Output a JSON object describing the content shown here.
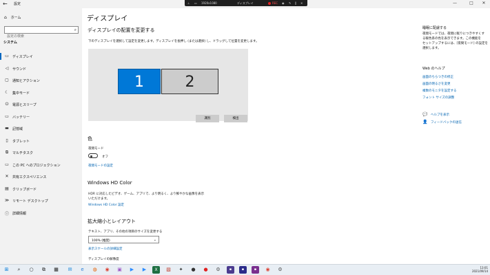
{
  "window": {
    "title": "設定",
    "back_icon": "back-arrow-icon",
    "controls": [
      "—",
      "□",
      "✕"
    ]
  },
  "recorder": {
    "resolution": "1920x1080",
    "display_title": "ディスプレイ",
    "rec_label": "REC"
  },
  "sidebar": {
    "home_label": "ホーム",
    "search_placeholder": "設定の検索",
    "section_label": "システム",
    "items": [
      {
        "label": "ディスプレイ",
        "icon": "monitor-icon",
        "selected": true
      },
      {
        "label": "サウンド",
        "icon": "speaker-icon"
      },
      {
        "label": "通知とアクション",
        "icon": "notification-icon"
      },
      {
        "label": "集中モード",
        "icon": "moon-icon"
      },
      {
        "label": "電源とスリープ",
        "icon": "power-icon"
      },
      {
        "label": "バッテリー",
        "icon": "battery-icon"
      },
      {
        "label": "記憶域",
        "icon": "storage-icon"
      },
      {
        "label": "タブレット",
        "icon": "tablet-icon"
      },
      {
        "label": "マルチタスク",
        "icon": "multitask-icon"
      },
      {
        "label": "この PC へのプロジェクション",
        "icon": "projection-icon"
      },
      {
        "label": "共有エクスペリエンス",
        "icon": "share-icon"
      },
      {
        "label": "クリップボード",
        "icon": "clipboard-icon"
      },
      {
        "label": "リモート デスクトップ",
        "icon": "remote-icon"
      },
      {
        "label": "詳細情報",
        "icon": "info-icon"
      }
    ]
  },
  "main": {
    "page_title": "ディスプレイ",
    "arrange_heading": "ディスプレイの配置を変更する",
    "arrange_desc": "下のディスプレイを選択して設定を変更します。ディスプレイを長押し (または選択) し、ドラッグして位置を変更します。",
    "monitor1": "1",
    "monitor2": "2",
    "identify_button": "識別",
    "detect_button": "検出",
    "color_heading": "色",
    "night_mode_label": "夜間モード",
    "night_mode_state": "オフ",
    "night_mode_link": "夜間モードの設定",
    "hdr_heading": "Windows HD Color",
    "hdr_desc_1": "HDR に対応したビデオ、ゲーム、アプリで、より明るく、より鮮やかな画像を表示",
    "hdr_desc_2": "いただけます。",
    "hdr_link": "Windows HD Color 設定",
    "scale_heading": "拡大縮小とレイアウト",
    "scale_label": "テキスト、アプリ、その他の項目のサイズを変更する",
    "scale_value": "100% (推奨)",
    "scale_link": "表示スケールの詳細設定",
    "resolution_label": "ディスプレイの解像度"
  },
  "right_panel": {
    "tip_heading": "睡眠に配慮する",
    "tip_text_1": "夜間モードでは、夜間に眠りにつきやすくす",
    "tip_text_2": "る暖色系の色を表示できます。この機能を",
    "tip_text_3": "セットアップするには、[夜間モード] の設定を",
    "tip_text_4": "選択します。",
    "web_help_heading": "Web のヘルプ",
    "links": [
      "画面のちらつきの修正",
      "画面の明るさを変更",
      "複数のモニタを設定する",
      "フォント サイズの調整"
    ],
    "help_label": "ヘルプを表示",
    "feedback_label": "フィードバックの送信"
  },
  "taskbar": {
    "icons": [
      "windows-start-icon",
      "search-icon",
      "cortana-icon",
      "task-view-icon",
      "widgets-icon",
      "mail-icon",
      "edge-icon",
      "firefox-icon",
      "chrome-icon",
      "photos-icon",
      "zoom-icon",
      "zoom-icon",
      "excel-icon",
      "app-icon",
      "pin-icon",
      "obs-icon",
      "record-icon",
      "settings-icon",
      "app-icon",
      "app-icon",
      "app-icon",
      "chrome-icon",
      "settings-icon"
    ],
    "time": "13:01",
    "date": "2021/09/14"
  },
  "colors": {
    "accent": "#0078d7",
    "link": "#0063b1",
    "sidebar_bg": "#f2f2f2",
    "taskbar_bg": "#e8eef4"
  }
}
